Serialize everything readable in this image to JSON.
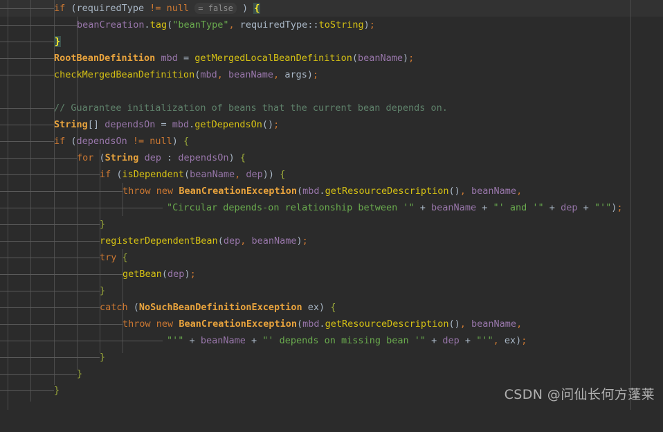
{
  "editor": {
    "theme_name": "darcula",
    "background": "#2b2b2b",
    "caret_line_background": "#323232",
    "guide_color": "#4d4d4d",
    "line_height_px": 24,
    "font_size_px": 13.5,
    "right_margin_line_x": 911
  },
  "colors": {
    "keyword": "#cc7832",
    "class_name": "#e8a33d",
    "method": "#d5c114",
    "variable": "#9876aa",
    "plain": "#a9b7c6",
    "string": "#6aab4e",
    "comment": "#5f826b",
    "brace": "#9aa83a",
    "inline_hint_text": "#8c8c8c",
    "inline_hint_background": "#3b3b3b",
    "matched_brace_background": "#3b514d",
    "matched_brace_text": "#ffef28"
  },
  "inline_hints": [
    {
      "text": "= false",
      "line": 1
    }
  ],
  "code": {
    "language": "java",
    "lines": [
      "if (requiredType != null = false ) {",
      "    beanCreation.tag(\"beanType\", requiredType::toString);",
      "}",
      "RootBeanDefinition mbd = getMergedLocalBeanDefinition(beanName);",
      "checkMergedBeanDefinition(mbd, beanName, args);",
      "",
      "// Guarantee initialization of beans that the current bean depends on.",
      "String[] dependsOn = mbd.getDependsOn();",
      "if (dependsOn != null) {",
      "    for (String dep : dependsOn) {",
      "        if (isDependent(beanName, dep)) {",
      "            throw new BeanCreationException(mbd.getResourceDescription(), beanName,",
      "                    \"Circular depends-on relationship between '\" + beanName + \"' and '\" + dep + \"'\");",
      "        }",
      "        registerDependentBean(dep, beanName);",
      "        try {",
      "            getBean(dep);",
      "        }",
      "        catch (NoSuchBeanDefinitionException ex) {",
      "            throw new BeanCreationException(mbd.getResourceDescription(), beanName,",
      "                    \"'\" + beanName + \"' depends on missing bean '\" + dep + \"'\", ex);",
      "        }",
      "    }",
      "}"
    ]
  },
  "watermark": {
    "text": "CSDN @问仙长何方蓬莱"
  }
}
